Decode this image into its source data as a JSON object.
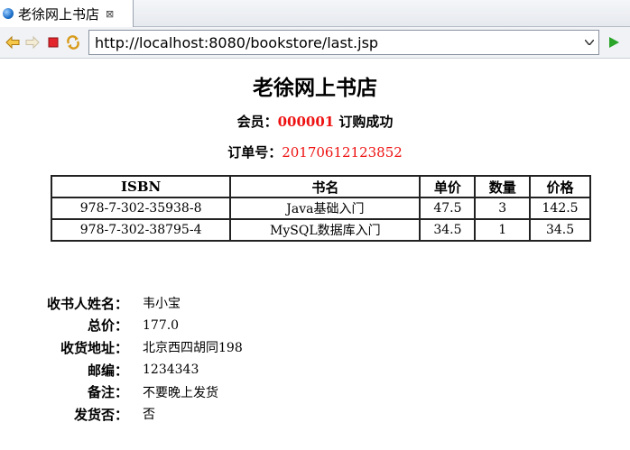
{
  "browser": {
    "tab_title": "老徐网上书店",
    "tab_close": "⊠",
    "url": "http://localhost:8080/bookstore/last.jsp"
  },
  "page": {
    "shop_title": "老徐网上书店",
    "member_label": "会员：",
    "member_id": "000001",
    "member_suffix": " 订购成功",
    "order_label": "订单号：",
    "order_number": "20170612123852"
  },
  "table": {
    "headers": [
      "ISBN",
      "书名",
      "单价",
      "数量",
      "价格"
    ],
    "rows": [
      [
        "978-7-302-35938-8",
        "Java基础入门",
        "47.5",
        "3",
        "142.5"
      ],
      [
        "978-7-302-38795-4",
        "MySQL数据库入门",
        "34.5",
        "1",
        "34.5"
      ]
    ]
  },
  "info": [
    {
      "label": "收书人姓名：",
      "value": "韦小宝"
    },
    {
      "label": "总价：",
      "value": "177.0"
    },
    {
      "label": "收货地址：",
      "value": "北京西四胡同198"
    },
    {
      "label": "邮编：",
      "value": "1234343"
    },
    {
      "label": "备注：",
      "value": "不要晚上发货"
    },
    {
      "label": "发货否：",
      "value": "否"
    }
  ],
  "colors": {
    "accent_red": "#ee1111",
    "go_green": "#2aa52a"
  }
}
